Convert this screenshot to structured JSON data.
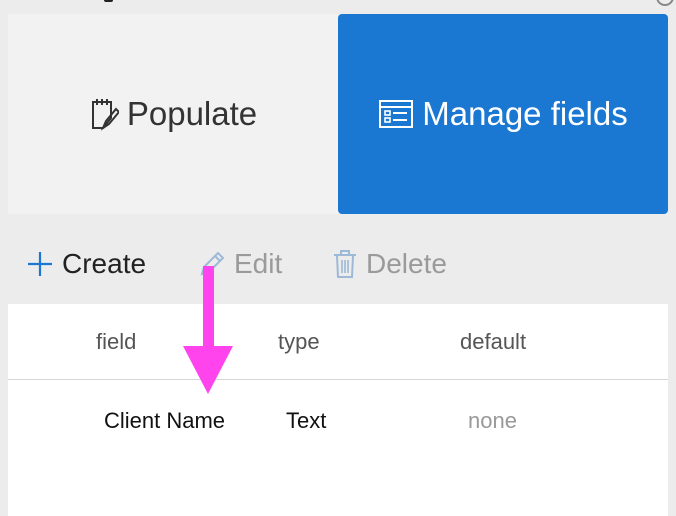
{
  "tabs": {
    "populate": {
      "label": "Populate",
      "icon": "notepad-edit-icon"
    },
    "manage": {
      "label": "Manage fields",
      "icon": "form-list-icon",
      "active": true
    }
  },
  "toolbar": {
    "create": {
      "label": "Create",
      "icon": "plus-icon"
    },
    "edit": {
      "label": "Edit",
      "icon": "pencil-icon",
      "disabled": true
    },
    "delete": {
      "label": "Delete",
      "icon": "trash-icon",
      "disabled": true
    }
  },
  "table": {
    "columns": [
      "field",
      "type",
      "default"
    ],
    "rows": [
      {
        "field": "Client Name",
        "type": "Text",
        "default": "none"
      }
    ]
  },
  "colors": {
    "accent": "#1a78d2",
    "annotation": "#ff44ee",
    "disabled": "#9a9a9a"
  }
}
